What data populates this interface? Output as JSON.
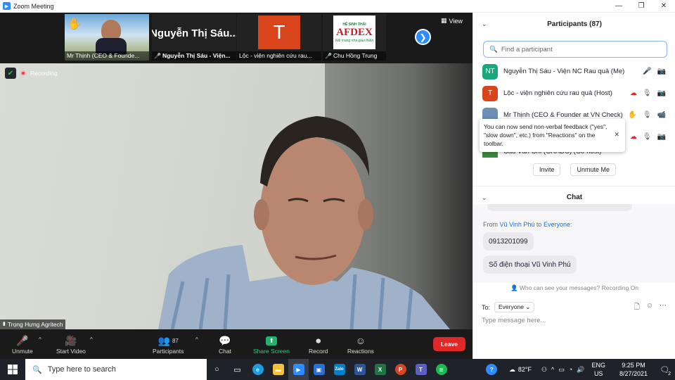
{
  "window": {
    "title": "Zoom Meeting"
  },
  "strip": {
    "thumbs": [
      {
        "name": "Mr Thịnh (CEO & Founde..."
      },
      {
        "name": "Nguyễn Thị Sáu - Viện...",
        "big_name": "Nguyễn Thị Sáu..."
      },
      {
        "name": "Lộc - viện nghiên cứu rau...",
        "letter": "T"
      },
      {
        "name": "Chu Hồng Trung",
        "logo": "AFDEX",
        "logo_top": "HỆ SINH THÁI",
        "logo_bottom": "Nối mạng nhà giao thiên"
      }
    ],
    "view_label": "View"
  },
  "video": {
    "recording_label": "Recording",
    "speaker_name": "Trọng Hưng Agritech"
  },
  "toolbar": {
    "unmute": "Unmute",
    "start_video": "Start Video",
    "participants": "Participants",
    "participants_count": "87",
    "chat": "Chat",
    "share_screen": "Share Screen",
    "record": "Record",
    "reactions": "Reactions",
    "leave": "Leave"
  },
  "participants_panel": {
    "title": "Participants (87)",
    "search_placeholder": "Find a participant",
    "rows": [
      {
        "initials": "NT",
        "name": "Nguyễn Thị Sáu - Viện NC Rau quả (Me)",
        "color": "#1ba67d"
      },
      {
        "initials": "T",
        "name": "Lộc - viện nghiên cứu rau quả (Host)",
        "color": "#d8441b"
      },
      {
        "initials": "",
        "name": "Mr Thịnh (CEO & Founder at VN Check)",
        "color": "#6b8fb5"
      },
      {
        "initials": "",
        "name": "",
        "color": "#888888"
      },
      {
        "initials": "",
        "name": "Cao Văn Chí (CRADC) (Co-host)",
        "color": "#3c8b3c"
      }
    ],
    "tooltip": "You can now send non-verbal feedback (\"yes\", \"slow down\", etc.) from \"Reactions\" on the toolbar.",
    "invite": "Invite",
    "unmute_me": "Unmute Me"
  },
  "chat_panel": {
    "title": "Chat",
    "from_label": "From",
    "from_name": "Vũ Vinh Phú",
    "to_label": "to",
    "to_name": "Everyone:",
    "messages": [
      "0913201099",
      "Số điện thoại Vũ Vinh Phú"
    ],
    "privacy_note": "Who can see your messages? Recording On",
    "to_prefix": "To:",
    "to_value": "Everyone",
    "input_placeholder": "Type message here..."
  },
  "taskbar": {
    "search_placeholder": "Type here to search",
    "weather": "82°F",
    "lang_top": "ENG",
    "lang_bottom": "US",
    "time": "9:25 PM",
    "date": "8/27/2021",
    "notifications": "2"
  }
}
